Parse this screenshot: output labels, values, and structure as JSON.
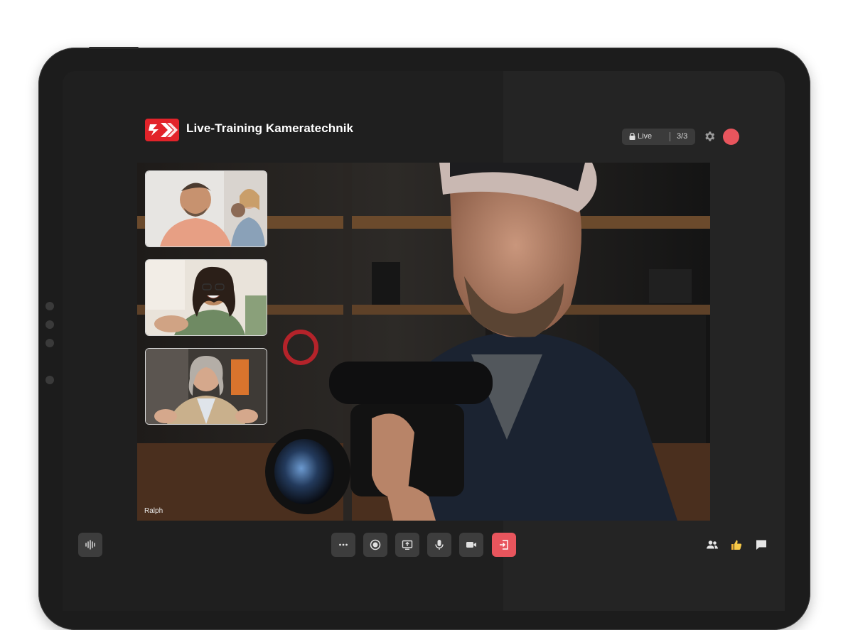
{
  "app": {
    "title": "Live-Training Kameratechnik"
  },
  "status": {
    "label": "Live",
    "participant_count": "3/3"
  },
  "stage": {
    "speaker_name": "Ralph"
  },
  "participants": [
    {
      "id": "participant-1"
    },
    {
      "id": "participant-2"
    },
    {
      "id": "participant-3"
    }
  ],
  "toolbar": {
    "left": [
      "audio-waveform-icon"
    ],
    "center": [
      "more-icon",
      "record-icon",
      "share-screen-icon",
      "microphone-icon",
      "camera-icon",
      "leave-icon"
    ],
    "right": [
      "participants-icon",
      "reaction-icon",
      "chat-icon"
    ]
  },
  "colors": {
    "accent": "#e8555d",
    "brand": "#e2232a",
    "background": "#242424",
    "button": "#3d3d3d"
  }
}
